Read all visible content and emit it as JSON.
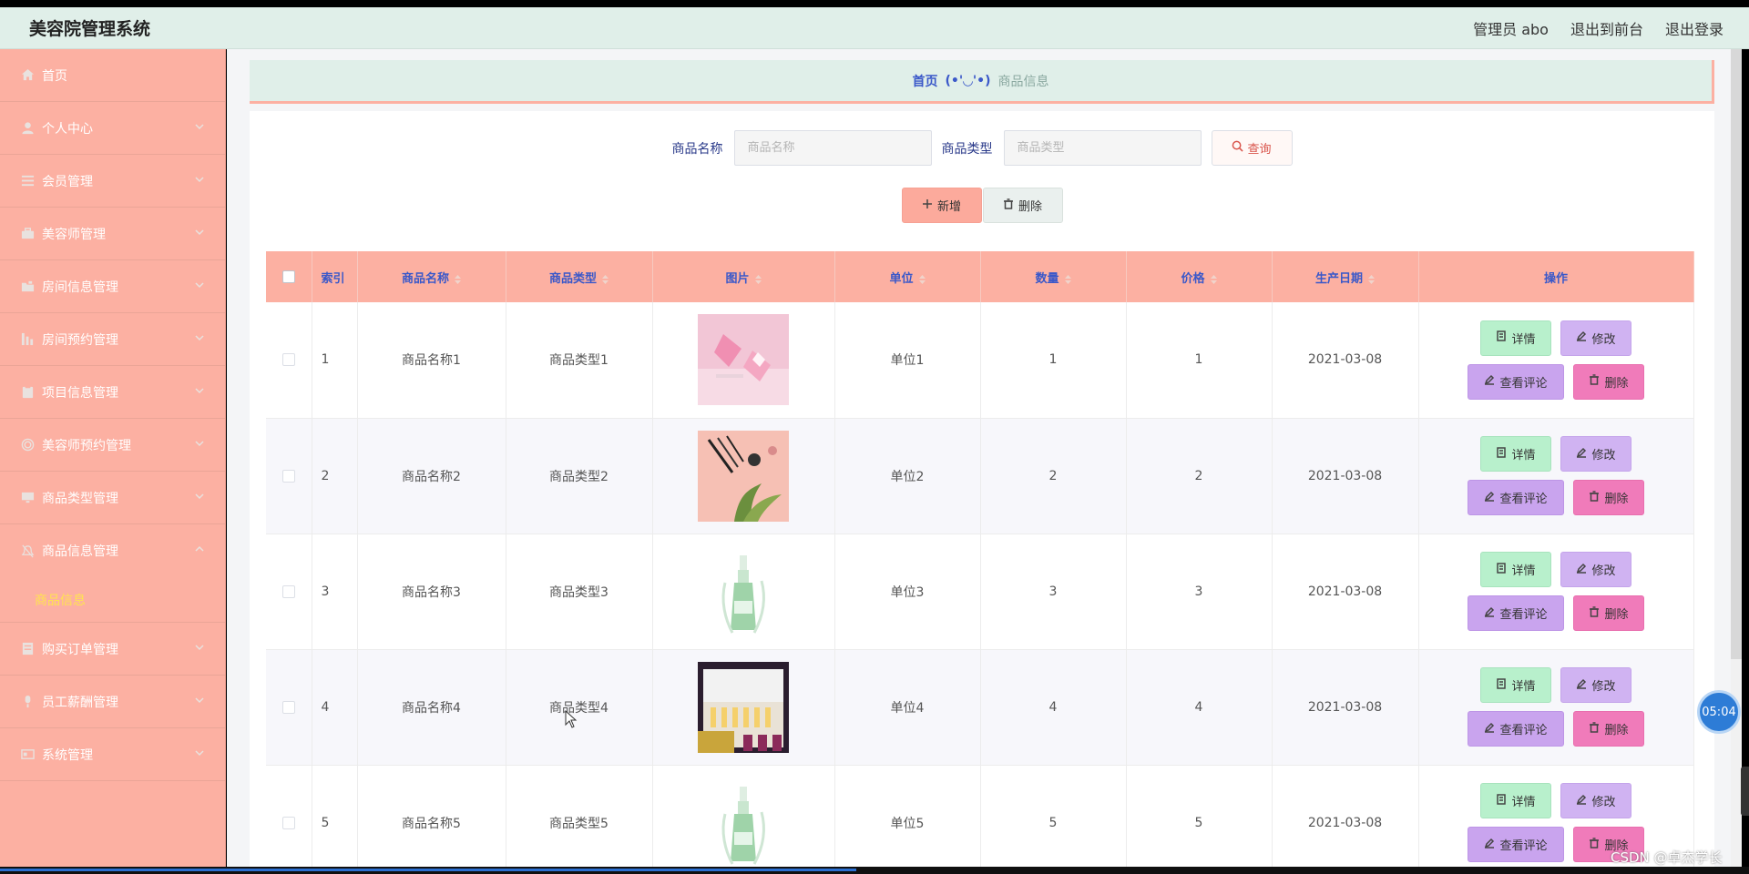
{
  "app": {
    "title": "美容院管理系统",
    "top_links": [
      "管理员 abo",
      "退出到前台",
      "退出登录"
    ]
  },
  "sidebar": {
    "items": [
      {
        "label": "首页",
        "icon": "home-icon",
        "has_chevron": false
      },
      {
        "label": "个人中心",
        "icon": "user-icon",
        "has_chevron": true
      },
      {
        "label": "会员管理",
        "icon": "list-icon",
        "has_chevron": true
      },
      {
        "label": "美容师管理",
        "icon": "briefcase-icon",
        "has_chevron": true
      },
      {
        "label": "房间信息管理",
        "icon": "folder-icon",
        "has_chevron": true
      },
      {
        "label": "房间预约管理",
        "icon": "chart-icon",
        "has_chevron": true
      },
      {
        "label": "项目信息管理",
        "icon": "clipboard-icon",
        "has_chevron": true
      },
      {
        "label": "美容师预约管理",
        "icon": "target-icon",
        "has_chevron": true
      },
      {
        "label": "商品类型管理",
        "icon": "monitor-icon",
        "has_chevron": true
      },
      {
        "label": "商品信息管理",
        "icon": "bell-off-icon",
        "has_chevron": true,
        "open": true
      },
      {
        "label": "购买订单管理",
        "icon": "receipt-icon",
        "has_chevron": true
      },
      {
        "label": "员工薪酬管理",
        "icon": "microphone-icon",
        "has_chevron": true
      },
      {
        "label": "系统管理",
        "icon": "id-card-icon",
        "has_chevron": true
      }
    ],
    "submenu_label": "商品信息"
  },
  "breadcrumb": {
    "home": "首页",
    "separator": "(•'◡'•)",
    "current": "商品信息"
  },
  "search": {
    "name_label": "商品名称",
    "name_placeholder": "商品名称",
    "type_label": "商品类型",
    "type_placeholder": "商品类型",
    "query_label": "查询"
  },
  "actions": {
    "add_label": "新增",
    "delete_label": "删除"
  },
  "table": {
    "headers": [
      "索引",
      "商品名称",
      "商品类型",
      "图片",
      "单位",
      "数量",
      "价格",
      "生产日期",
      "操作"
    ],
    "rows": [
      {
        "index": "1",
        "name": "商品名称1",
        "type": "商品类型1",
        "image": "pink-cosmetic-device",
        "unit": "单位1",
        "qty": "1",
        "price": "1",
        "date": "2021-03-08"
      },
      {
        "index": "2",
        "name": "商品名称2",
        "type": "商品类型2",
        "image": "makeup-brushes-flatlay",
        "unit": "单位2",
        "qty": "2",
        "price": "2",
        "date": "2021-03-08"
      },
      {
        "index": "3",
        "name": "商品名称3",
        "type": "商品类型3",
        "image": "green-lotion-bottle",
        "unit": "单位3",
        "qty": "3",
        "price": "3",
        "date": "2021-03-08"
      },
      {
        "index": "4",
        "name": "商品名称4",
        "type": "商品类型4",
        "image": "ampoule-gift-box",
        "unit": "单位4",
        "qty": "4",
        "price": "4",
        "date": "2021-03-08"
      },
      {
        "index": "5",
        "name": "商品名称5",
        "type": "商品类型5",
        "image": "green-lotion-bottle",
        "unit": "单位5",
        "qty": "5",
        "price": "5",
        "date": "2021-03-08"
      }
    ],
    "row_actions": {
      "detail": "详情",
      "edit": "修改",
      "review": "查看评论",
      "delete": "删除"
    }
  },
  "overlay": {
    "timer": "05:04",
    "watermark": "CSDN @卓杰学长"
  },
  "colors": {
    "sidebar_bg": "#fcb0a2",
    "header_bg": "#e0efe9",
    "table_header_bg": "#fcb0a2",
    "accent_blue": "#3a58c9",
    "active_submenu": "#ffe44f"
  }
}
